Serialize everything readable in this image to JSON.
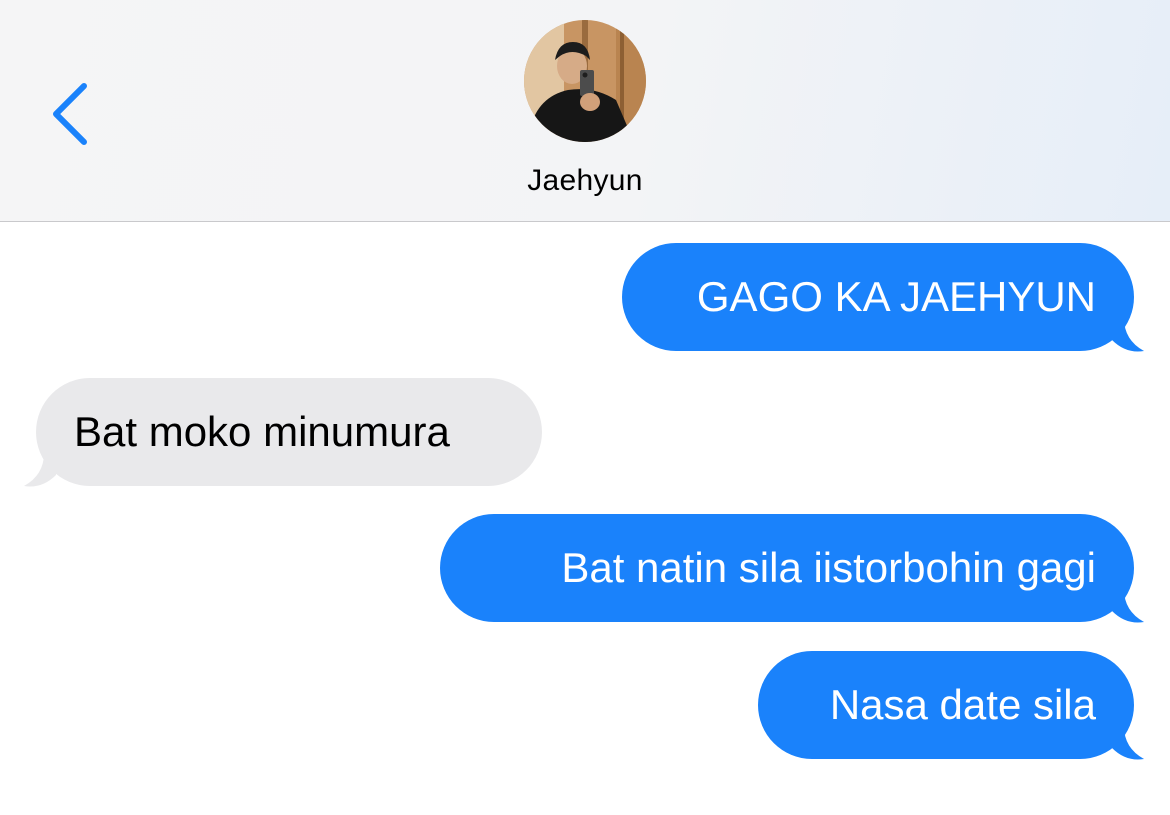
{
  "header": {
    "contact_name": "Jaehyun"
  },
  "icons": {
    "back": "chevron-left-icon",
    "avatar": "contact-photo"
  },
  "colors": {
    "sent_bubble": "#1a82fb",
    "received_bubble": "#e9e9eb",
    "accent": "#1a82fb"
  },
  "messages": [
    {
      "direction": "sent",
      "text": "GAGO KA JAEHYUN"
    },
    {
      "direction": "received",
      "text": "Bat moko minumura"
    },
    {
      "direction": "sent",
      "text": "Bat natin sila iistorbohin gagi"
    },
    {
      "direction": "sent",
      "text": "Nasa date sila"
    }
  ]
}
